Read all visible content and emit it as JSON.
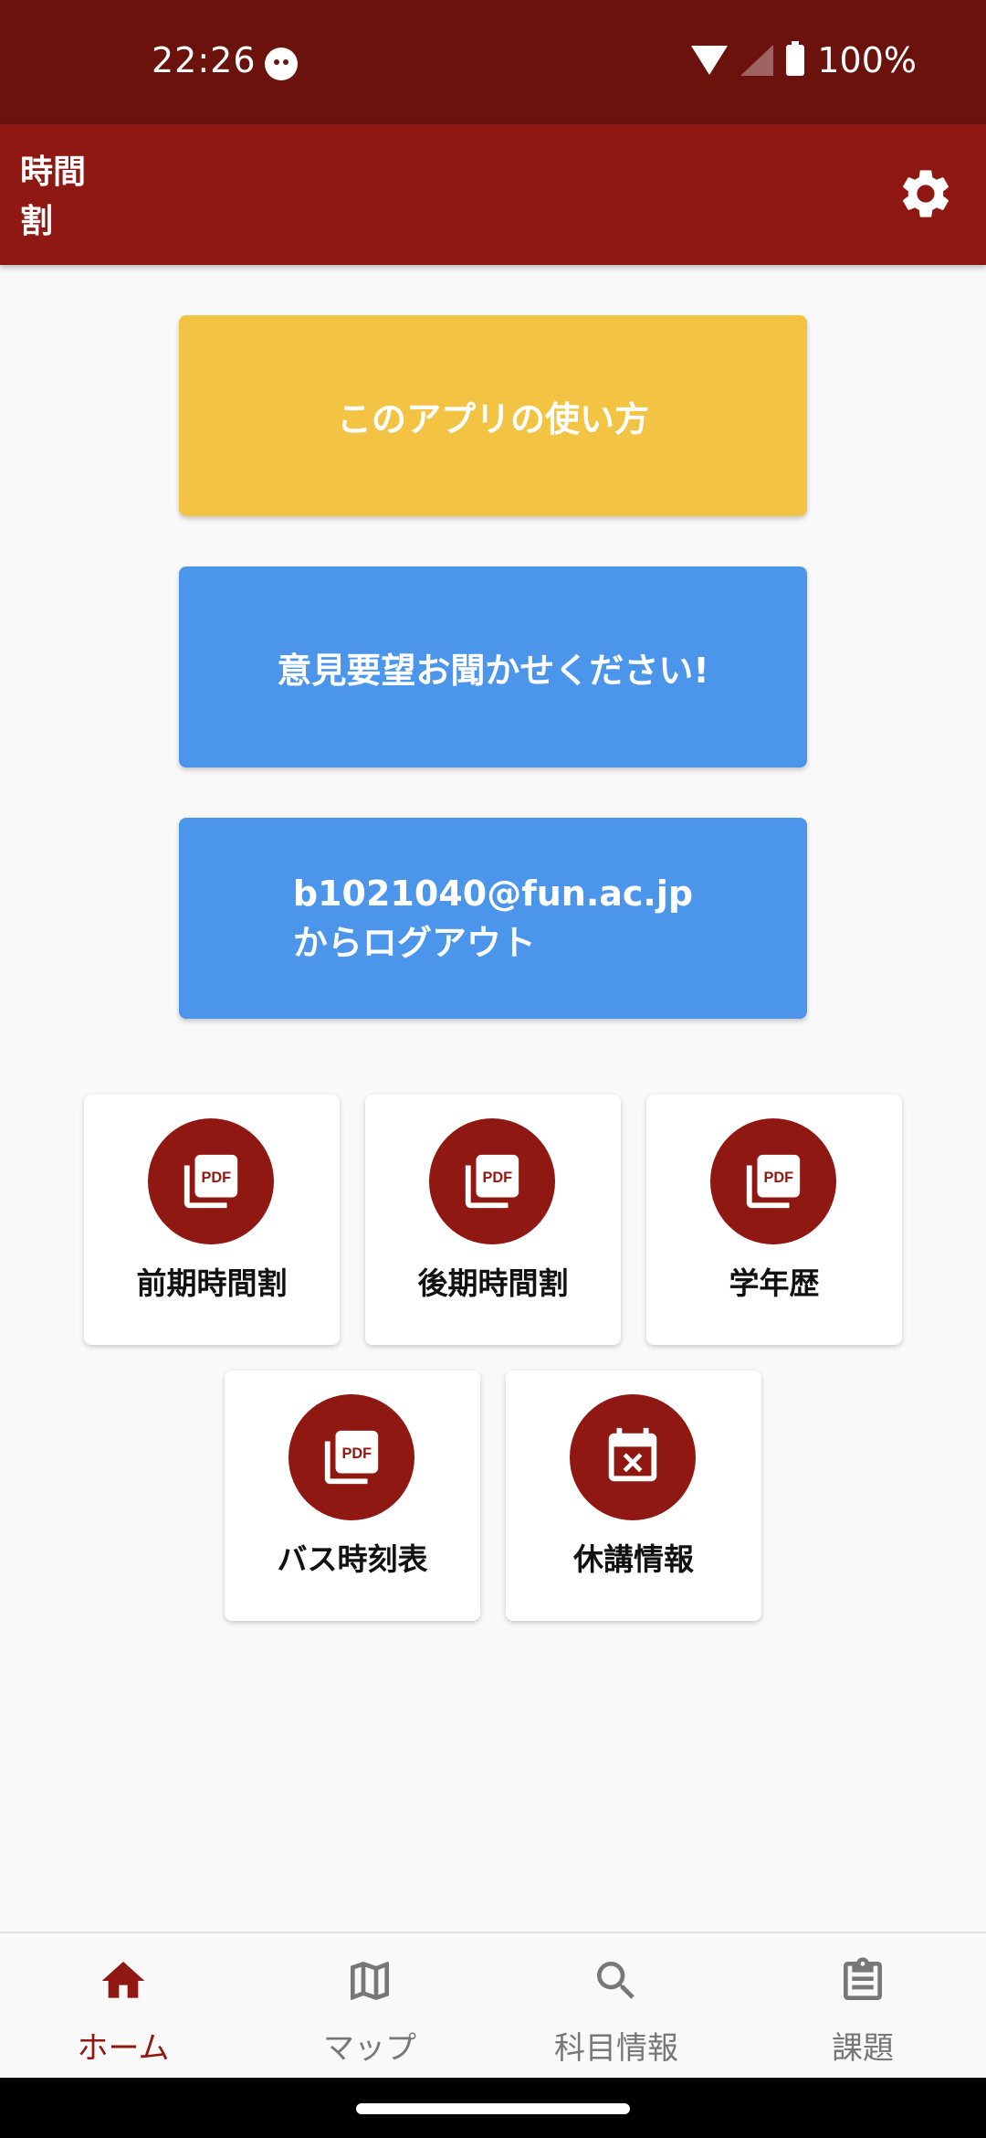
{
  "status_bar": {
    "time": "22:26",
    "battery": "100%"
  },
  "app_bar": {
    "title": "時間割"
  },
  "buttons": {
    "guide": "このアプリの使い方",
    "feedback": "意見要望お聞かせください!",
    "logout_email": "b1021040@fun.ac.jp",
    "logout_suffix": "からログアウト"
  },
  "tiles": [
    {
      "label": "前期時間割",
      "icon": "pdf-icon"
    },
    {
      "label": "後期時間割",
      "icon": "pdf-icon"
    },
    {
      "label": "学年歴",
      "icon": "pdf-icon"
    },
    {
      "label": "バス時刻表",
      "icon": "pdf-icon"
    },
    {
      "label": "休講情報",
      "icon": "calendar-cancel-icon"
    }
  ],
  "bottom_nav": [
    {
      "label": "ホーム",
      "icon": "home-icon",
      "active": true
    },
    {
      "label": "マップ",
      "icon": "map-icon",
      "active": false
    },
    {
      "label": "科目情報",
      "icon": "search-icon",
      "active": false
    },
    {
      "label": "課題",
      "icon": "clipboard-icon",
      "active": false
    }
  ],
  "colors": {
    "primary": "#8f1812",
    "status": "#6b120d",
    "yellow": "#f3c444",
    "blue": "#4b95eb"
  }
}
